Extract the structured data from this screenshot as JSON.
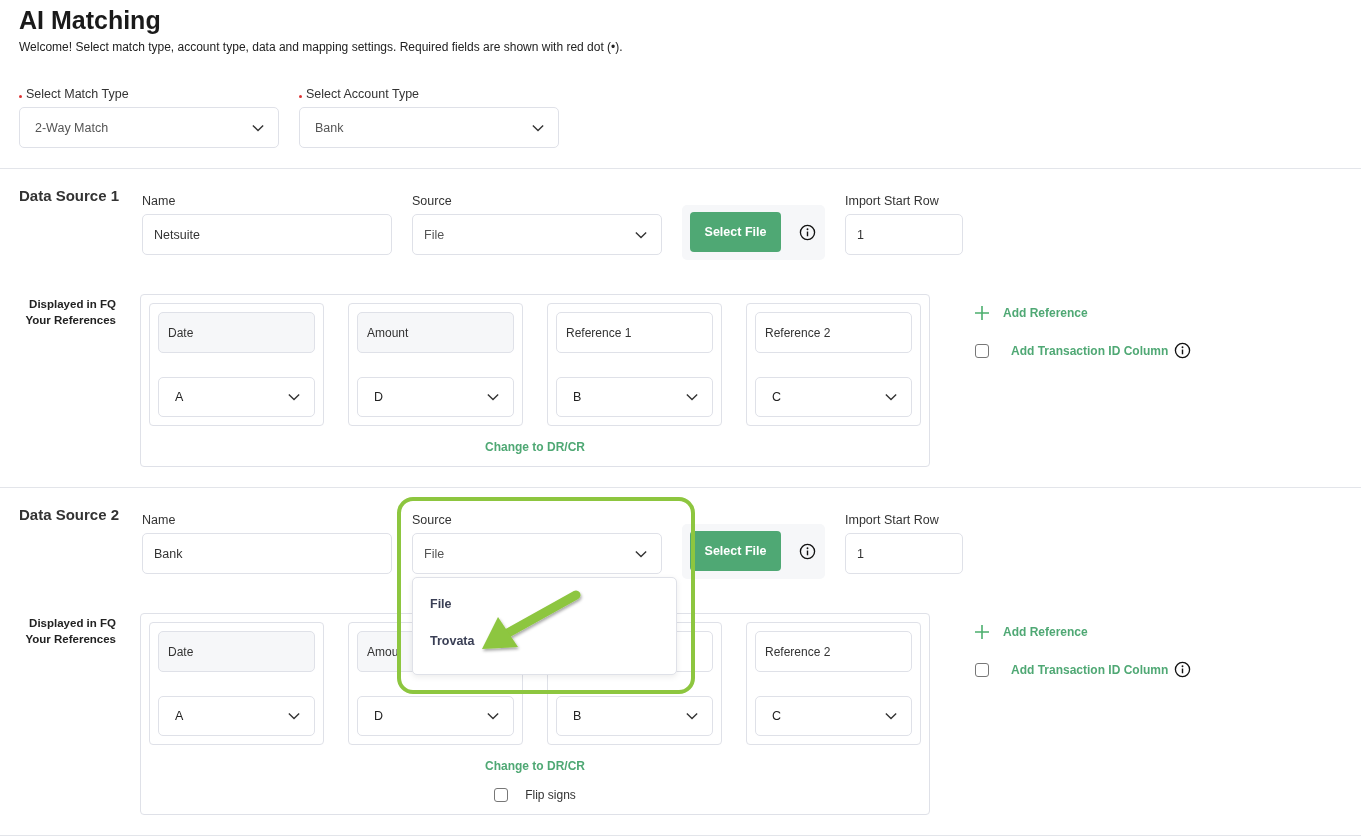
{
  "title": "AI Matching",
  "subtitle": "Welcome! Select match type, account type, data and mapping settings. Required fields are shown with red dot (•).",
  "selects": [
    {
      "label": "Select Match Type",
      "required": true,
      "value": "2-Way Match"
    },
    {
      "label": "Select Account Type",
      "required": true,
      "value": "Bank"
    }
  ],
  "data_sources": [
    {
      "title": "Data Source 1",
      "name_label": "Name",
      "name_value": "Netsuite",
      "source_label": "Source",
      "source_value": "File",
      "select_file": "Select File",
      "import_label": "Import Start Row",
      "import_value": "1",
      "mapping_label": [
        "Displayed in FQ",
        "Your References"
      ],
      "columns": [
        {
          "kind": "fixed",
          "field": "Date",
          "column": "A"
        },
        {
          "kind": "fixed",
          "field": "Amount",
          "column": "D"
        },
        {
          "kind": "custom",
          "field": "Reference 1",
          "column": "B"
        },
        {
          "kind": "custom",
          "field": "Reference 2",
          "column": "C"
        }
      ],
      "change_link": "Change to DR/CR",
      "add_reference": "Add Reference",
      "transaction_id": {
        "label": "Add Transaction ID Column",
        "checked": false
      }
    },
    {
      "title": "Data Source 2",
      "name_label": "Name",
      "name_value": "Bank",
      "source_label": "Source",
      "source_value": "File",
      "select_file": "Select File",
      "import_label": "Import Start Row",
      "import_value": "1",
      "mapping_label": [
        "Displayed in FQ",
        "Your References"
      ],
      "columns": [
        {
          "kind": "fixed",
          "field": "Date",
          "column": "A"
        },
        {
          "kind": "fixed",
          "field": "Amou",
          "column": "D"
        },
        {
          "kind": "custom",
          "column": "B"
        },
        {
          "kind": "custom",
          "field": "Reference 2",
          "column": "C"
        }
      ],
      "change_link": "Change to DR/CR",
      "flip_signs": {
        "label": "Flip signs",
        "checked": false
      },
      "add_reference": "Add Reference",
      "transaction_id": {
        "label": "Add Transaction ID Column",
        "checked": false
      },
      "dropdown": {
        "options": [
          {
            "label": "File",
            "selected": false
          },
          {
            "label": "Trovata",
            "selected": false
          }
        ],
        "highlighted": true
      }
    }
  ]
}
